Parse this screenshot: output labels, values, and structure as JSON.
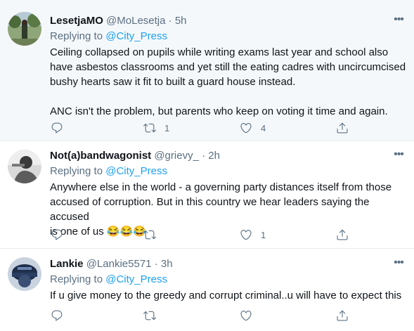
{
  "tweets": [
    {
      "name": "LesetjaMO",
      "handle": "@MoLesetja",
      "dot": "·",
      "time": "5h",
      "replying_prefix": "Replying to",
      "replying_to": "@City_Press",
      "text_lines": [
        "Ceiling collapsed on pupils while writing exams last year and school also",
        "have asbestos classrooms and yet still the eating cadres with uncircumcised",
        "bushy hearts saw it fit to built a guard house instead."
      ],
      "text_para2": "ANC isn't the problem, but parents who keep on voting it time and again.",
      "retweets": "1",
      "likes": "4",
      "replies": ""
    },
    {
      "name": "Not(a)bandwagonist",
      "handle": "@grievy_",
      "dot": "·",
      "time": "2h",
      "replying_prefix": "Replying to",
      "replying_to": "@City_Press",
      "text_lines": [
        "Anywhere else in the world - a governing party distances itself from those",
        "accused of corruption. But in this country we hear leaders saying the accused",
        "is one of us 😂😂😂"
      ],
      "retweets": "",
      "likes": "1",
      "replies": ""
    },
    {
      "name": "Lankie",
      "handle": "@Lankie5571",
      "dot": "·",
      "time": "3h",
      "replying_prefix": "Replying to",
      "replying_to": "@City_Press",
      "text_lines": [
        "If u give money to the greedy and corrupt criminal..u will have to expect this"
      ],
      "retweets": "",
      "likes": "",
      "replies": ""
    }
  ],
  "more_label": "•••",
  "colors": {
    "accent": "#1da1f2",
    "muted": "#5b7083",
    "highlight_bg": "#f5f8fa",
    "border": "#e6ecf0"
  },
  "icons": [
    "more-icon",
    "reply-icon",
    "retweet-icon",
    "like-icon",
    "share-icon"
  ]
}
